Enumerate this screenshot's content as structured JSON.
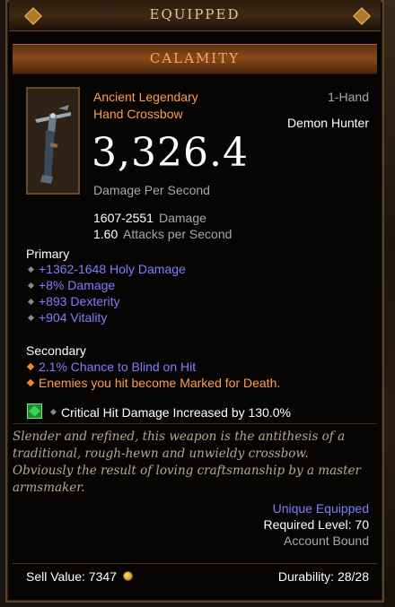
{
  "header": {
    "title": "EQUIPPED"
  },
  "item": {
    "name": "CALAMITY",
    "rarity": "Ancient Legendary",
    "type": "Hand Crossbow",
    "slot": "1-Hand",
    "class": "Demon Hunter",
    "dps": "3,326.4",
    "dps_label": "Damage Per Second",
    "damage_value": "1607-2551",
    "damage_label": "Damage",
    "aps_value": "1.60",
    "aps_label": "Attacks per Second",
    "icon": "hand-crossbow-icon"
  },
  "primary": {
    "heading": "Primary",
    "stats": [
      "+1362-1648 Holy Damage",
      "+8% Damage",
      "+893 Dexterity",
      "+904 Vitality"
    ]
  },
  "secondary": {
    "heading": "Secondary",
    "stats": [
      "2.1% Chance to Blind on Hit",
      "Enemies you hit become Marked for Death."
    ]
  },
  "socket": {
    "gem": "emerald-gem-icon",
    "text": "Critical Hit Damage Increased by 130.0%"
  },
  "flavor": "Slender and refined, this weapon is the antithesis of a traditional, rough-hewn and unwieldy crossbow. Obviously the result of loving craftsmanship by a master armsmaker.",
  "requirements": {
    "unique": "Unique Equipped",
    "level": "Required Level: 70",
    "bound": "Account Bound"
  },
  "footer": {
    "sell_value": "Sell Value: 7347",
    "durability": "Durability: 28/28"
  },
  "colors": {
    "legendary_orange": "#ff9e4a",
    "magic_blue": "#7d7dff",
    "frame_bronze": "#5a4428"
  }
}
